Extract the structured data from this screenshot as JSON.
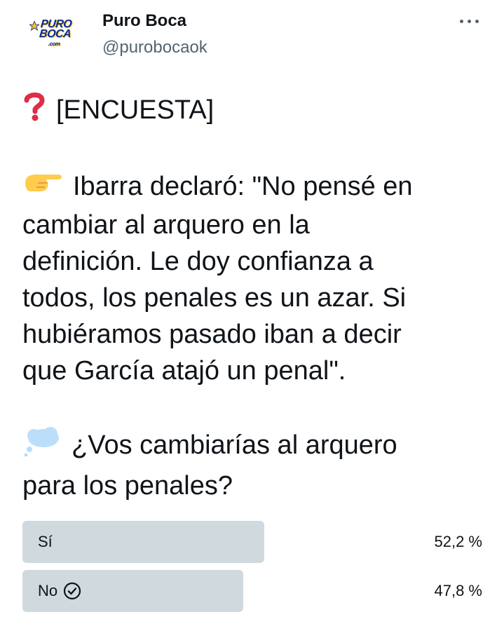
{
  "tweet": {
    "author_name": "Puro Boca",
    "author_handle": "@purobocaok",
    "avatar_logo": {
      "line1": "PURO",
      "line2": "BOCA",
      "line3": ".com"
    },
    "text_lines": [
      "[ENCUESTA]",
      "Ibarra declaró: \"No pensé en",
      "cambiar al arquero en la",
      "definición. Le doy confianza a",
      "todos, los penales es un azar. Si",
      "hubiéramos pasado iban a decir",
      "que García atajó un penal\".",
      "¿Vos cambiarías al arquero",
      "para los penales?"
    ]
  },
  "poll": {
    "options": [
      {
        "label": "Sí",
        "percent_text": "52,2 %",
        "percent": 52.2,
        "winner": false
      },
      {
        "label": "No",
        "percent_text": "47,8 %",
        "percent": 47.8,
        "winner": true
      }
    ],
    "bar_color": "#cfd9de"
  },
  "icons": {
    "question": "red-question-mark-icon",
    "pointing": "backhand-index-pointing-right-icon",
    "thought": "thought-balloon-icon",
    "check": "check-circle-icon",
    "more": "more-options-icon"
  }
}
